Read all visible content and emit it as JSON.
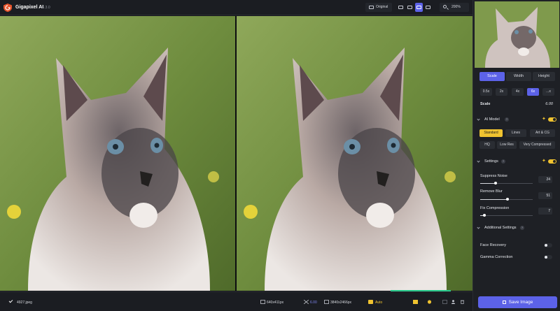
{
  "app": {
    "title": "Gigapixel AI",
    "version": "v6.3.0"
  },
  "toolbar": {
    "original_label": "Original",
    "zoom_label": "200%"
  },
  "status": {
    "filename": "4927.jpeg",
    "input_size": "640x411px",
    "scale": "6.00",
    "output_size": "3840x2466px",
    "auto_label": "Auto"
  },
  "panel": {
    "tabs": [
      {
        "label": "Scale"
      },
      {
        "label": "Width"
      },
      {
        "label": "Height"
      }
    ],
    "scale_options": [
      {
        "label": "0.5x"
      },
      {
        "label": "2x"
      },
      {
        "label": "4x"
      },
      {
        "label": "6x"
      },
      {
        "label": "...x"
      }
    ],
    "scale_label": "Scale",
    "scale_value": "6.00",
    "ai_model": {
      "title": "AI Model",
      "help": "?",
      "models_row1": [
        {
          "label": "Standard"
        },
        {
          "label": "Lines"
        },
        {
          "label": "Art & CG"
        }
      ],
      "models_row2": [
        {
          "label": "HQ"
        },
        {
          "label": "Low Res"
        },
        {
          "label": "Very Compressed"
        }
      ]
    },
    "settings": {
      "title": "Settings",
      "help": "?",
      "suppress_noise": {
        "label": "Suppress Noise",
        "value": "24"
      },
      "remove_blur": {
        "label": "Remove Blur",
        "value": "51"
      },
      "fix_compression": {
        "label": "Fix Compression",
        "value": "7"
      }
    },
    "additional": {
      "title": "Additional Settings",
      "help": "?",
      "face_recovery": "Face Recovery",
      "gamma_correction": "Gamma Correction"
    },
    "save_label": "Save Image"
  },
  "colors": {
    "accent": "#5c62e8",
    "highlight": "#f0c330",
    "progress": "#27c98a"
  }
}
